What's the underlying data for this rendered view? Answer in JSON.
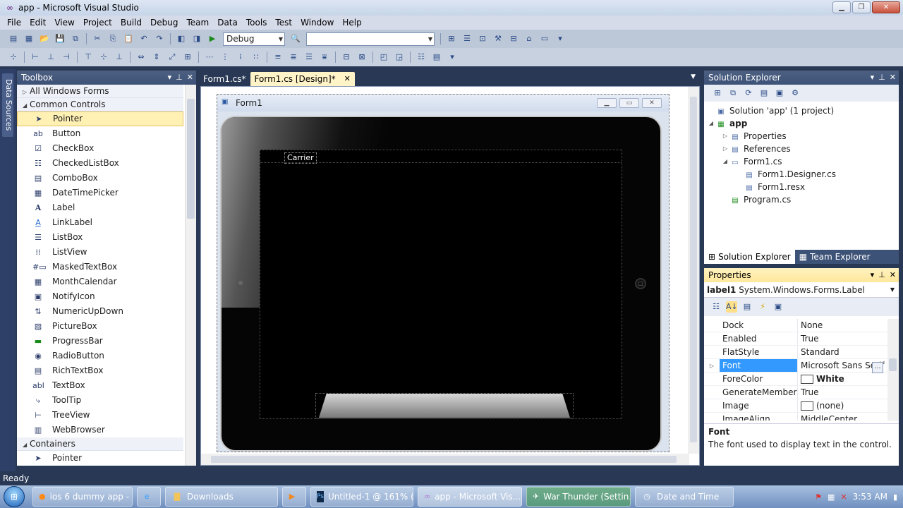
{
  "window": {
    "title": "app - Microsoft Visual Studio"
  },
  "menu": [
    "File",
    "Edit",
    "View",
    "Project",
    "Build",
    "Debug",
    "Team",
    "Data",
    "Tools",
    "Test",
    "Window",
    "Help"
  ],
  "toolbar": {
    "config": "Debug",
    "platform": ""
  },
  "left_strip": {
    "label": "Data Sources"
  },
  "toolbox": {
    "title": "Toolbox",
    "sections": [
      {
        "label": "All Windows Forms",
        "expanded": false,
        "items": []
      },
      {
        "label": "Common Controls",
        "expanded": true,
        "items": [
          {
            "label": "Pointer",
            "icon": "pointer-icon",
            "selected": true
          },
          {
            "label": "Button",
            "icon": "button-icon"
          },
          {
            "label": "CheckBox",
            "icon": "checkbox-icon"
          },
          {
            "label": "CheckedListBox",
            "icon": "checkedlistbox-icon"
          },
          {
            "label": "ComboBox",
            "icon": "combobox-icon"
          },
          {
            "label": "DateTimePicker",
            "icon": "datetimepicker-icon"
          },
          {
            "label": "Label",
            "icon": "label-icon"
          },
          {
            "label": "LinkLabel",
            "icon": "linklabel-icon"
          },
          {
            "label": "ListBox",
            "icon": "listbox-icon"
          },
          {
            "label": "ListView",
            "icon": "listview-icon"
          },
          {
            "label": "MaskedTextBox",
            "icon": "maskedtextbox-icon"
          },
          {
            "label": "MonthCalendar",
            "icon": "monthcalendar-icon"
          },
          {
            "label": "NotifyIcon",
            "icon": "notifyicon-icon"
          },
          {
            "label": "NumericUpDown",
            "icon": "numericupdown-icon"
          },
          {
            "label": "PictureBox",
            "icon": "picturebox-icon"
          },
          {
            "label": "ProgressBar",
            "icon": "progressbar-icon"
          },
          {
            "label": "RadioButton",
            "icon": "radiobutton-icon"
          },
          {
            "label": "RichTextBox",
            "icon": "richtextbox-icon"
          },
          {
            "label": "TextBox",
            "icon": "textbox-icon"
          },
          {
            "label": "ToolTip",
            "icon": "tooltip-icon"
          },
          {
            "label": "TreeView",
            "icon": "treeview-icon"
          },
          {
            "label": "WebBrowser",
            "icon": "webbrowser-icon"
          }
        ]
      },
      {
        "label": "Containers",
        "expanded": true,
        "items": [
          {
            "label": "Pointer",
            "icon": "pointer-icon"
          }
        ]
      }
    ]
  },
  "doc_tabs": [
    {
      "label": "Form1.cs*",
      "active": false
    },
    {
      "label": "Form1.cs [Design]*",
      "active": true
    }
  ],
  "designer": {
    "form_title": "Form1",
    "carrier_label": "Carrier"
  },
  "solution_explorer": {
    "title": "Solution Explorer",
    "nodes": [
      {
        "label": "Solution 'app' (1 project)",
        "level": 0,
        "exp": "",
        "icon": "solution-icon"
      },
      {
        "label": "app",
        "level": 0,
        "exp": "expanded",
        "icon": "csharp-project-icon",
        "bold": true
      },
      {
        "label": "Properties",
        "level": 1,
        "exp": "collapsed",
        "icon": "properties-folder-icon"
      },
      {
        "label": "References",
        "level": 1,
        "exp": "collapsed",
        "icon": "references-folder-icon"
      },
      {
        "label": "Form1.cs",
        "level": 1,
        "exp": "expanded",
        "icon": "form-file-icon"
      },
      {
        "label": "Form1.Designer.cs",
        "level": 2,
        "exp": "",
        "icon": "cs-file-icon"
      },
      {
        "label": "Form1.resx",
        "level": 2,
        "exp": "",
        "icon": "resx-file-icon"
      },
      {
        "label": "Program.cs",
        "level": 1,
        "exp": "",
        "icon": "cs-file-icon"
      }
    ],
    "bottom_tabs": [
      "Solution Explorer",
      "Team Explorer"
    ]
  },
  "properties": {
    "title": "Properties",
    "object_name": "label1",
    "object_type": "System.Windows.Forms.Label",
    "rows": [
      {
        "name": "Dock",
        "value": "None"
      },
      {
        "name": "Enabled",
        "value": "True"
      },
      {
        "name": "FlatStyle",
        "value": "Standard"
      },
      {
        "name": "Font",
        "value": "Microsoft Sans Serif",
        "selected": true,
        "expandable": true
      },
      {
        "name": "ForeColor",
        "value": "White",
        "swatch": "#ffffff",
        "bold": true
      },
      {
        "name": "GenerateMember",
        "value": "True"
      },
      {
        "name": "Image",
        "value": "(none)",
        "swatch": "#ffffff"
      },
      {
        "name": "ImageAlign",
        "value": "MiddleCenter"
      }
    ],
    "description_name": "Font",
    "description_text": "The font used to display text in the control."
  },
  "status": {
    "text": "Ready"
  },
  "taskbar": {
    "tasks": [
      {
        "label": "ios 6 dummy app - ...",
        "icon": "firefox-icon"
      },
      {
        "label": "",
        "icon": "ie-icon"
      },
      {
        "label": "Downloads",
        "icon": "folder-icon"
      },
      {
        "label": "",
        "icon": "media-player-icon"
      },
      {
        "label": "Untitled-1 @ 161% (...",
        "icon": "photoshop-icon"
      },
      {
        "label": "app - Microsoft Vis...",
        "icon": "visual-studio-icon",
        "active": true
      },
      {
        "label": "War Thunder (Settin...",
        "icon": "war-thunder-icon"
      },
      {
        "label": "Date and Time",
        "icon": "date-time-icon"
      }
    ],
    "clock": "3:53 AM"
  },
  "colors": {
    "accent": "#293955",
    "selection": "#3399ff",
    "highlight": "#fff0b4"
  }
}
